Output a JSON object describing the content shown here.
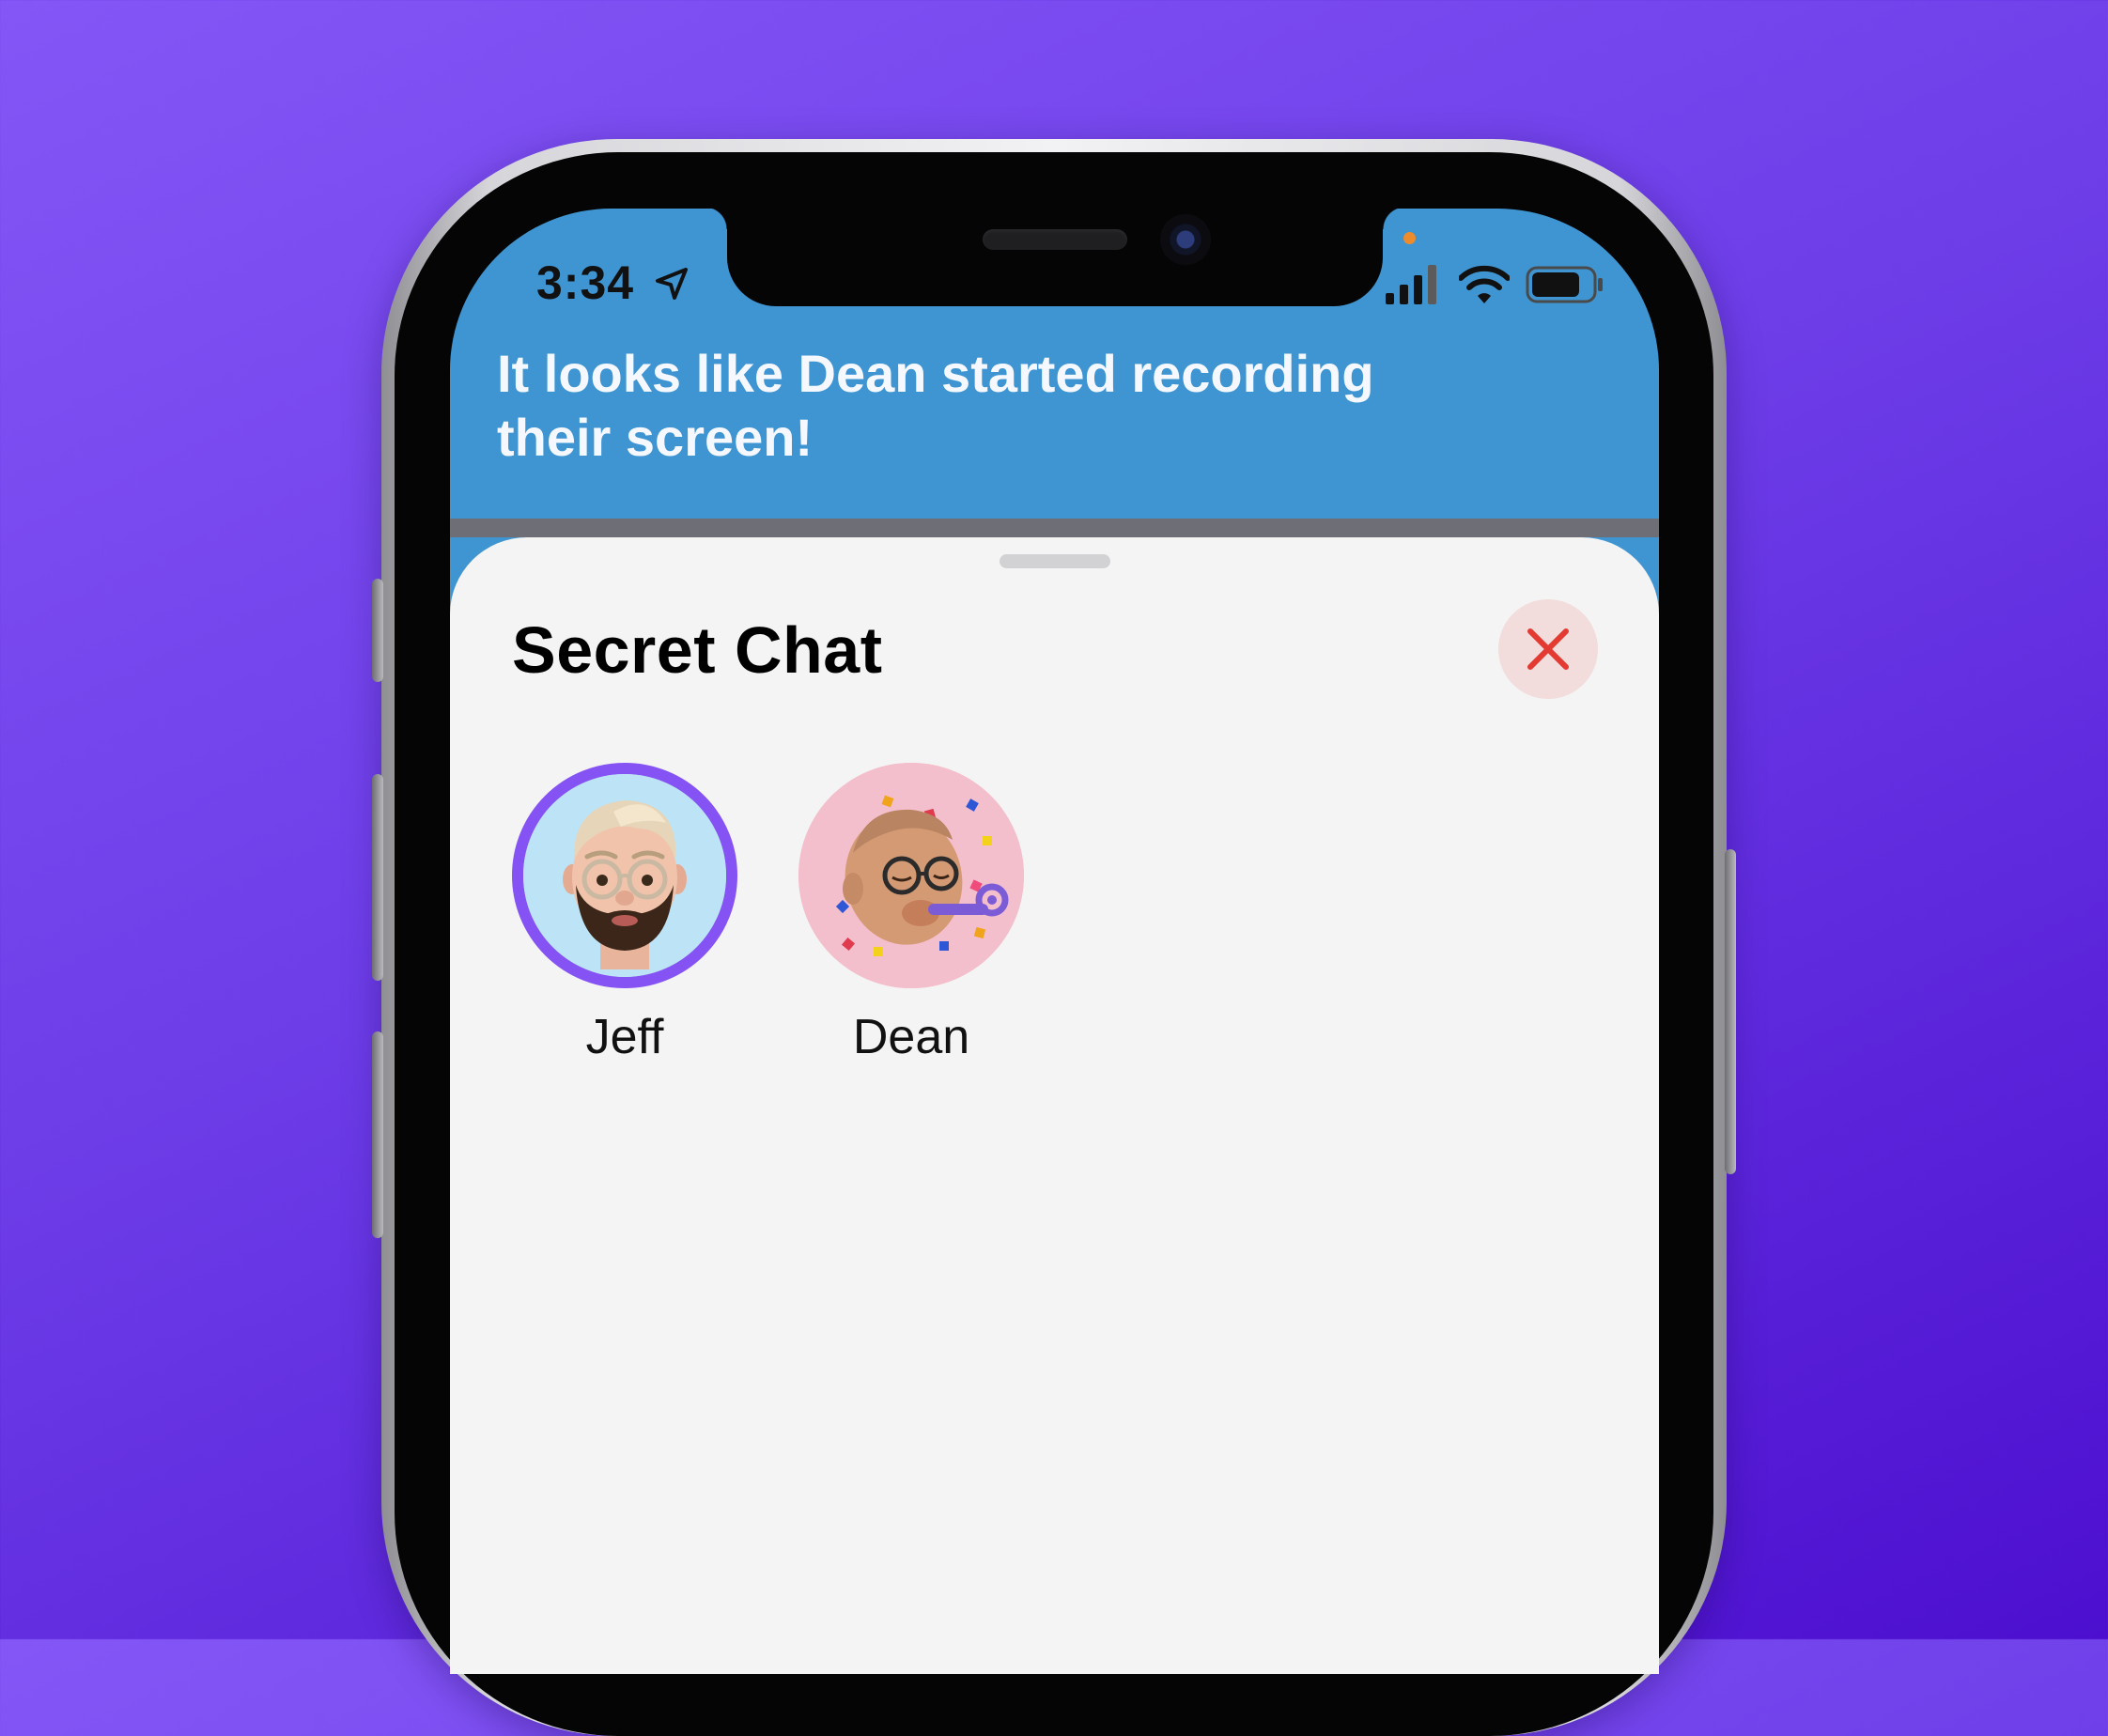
{
  "status_bar": {
    "time": "3:34",
    "icons": [
      "location-arrow-icon",
      "cellular-signal-icon",
      "wifi-icon",
      "battery-icon"
    ]
  },
  "banner": {
    "message": "It looks like Dean started recording their screen!",
    "background_color": "#3f95d2"
  },
  "sheet": {
    "title": "Secret Chat",
    "close_icon": "close-icon",
    "close_color": "#e33b32"
  },
  "participants": [
    {
      "name": "Jeff",
      "avatar": "memoji-avatar",
      "selected": true,
      "ring_color": "#8553f3",
      "background_color": "#bde3f6"
    },
    {
      "name": "Dean",
      "avatar": "memoji-avatar",
      "selected": false,
      "background_color": "#f4bfcc"
    }
  ],
  "colors": {
    "page_background": "#6d3de8",
    "sheet_background": "#f4f4f4"
  }
}
